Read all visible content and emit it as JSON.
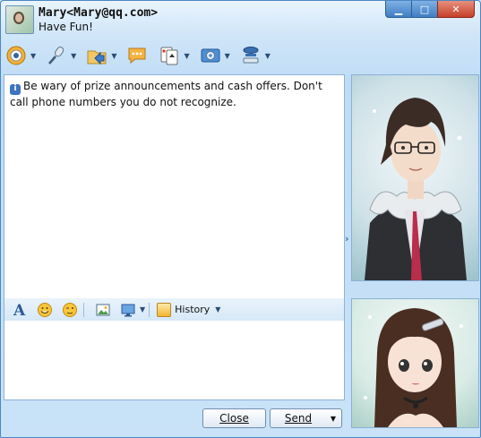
{
  "header": {
    "contact_title": "Mary<Mary@qq.com>",
    "status_message": "Have Fun!",
    "window_buttons": {
      "minimize": "▁",
      "maximize": "□",
      "close": "✕"
    }
  },
  "toolbar": {
    "items": [
      {
        "icon": "video-call-icon"
      },
      {
        "icon": "voice-call-icon"
      },
      {
        "icon": "send-file-icon"
      },
      {
        "icon": "sms-icon"
      },
      {
        "icon": "games-icon"
      },
      {
        "icon": "apps-icon"
      },
      {
        "icon": "more-icon"
      }
    ]
  },
  "messages": {
    "notice": "Be wary of prize announcements and cash offers. Don't call phone numbers you do not recognize."
  },
  "format_toolbar": {
    "history_label": "History"
  },
  "buttons": {
    "close_label": "Close",
    "send_label": "Send"
  },
  "colors": {
    "window_border": "#4a86c4",
    "accent": "#3d74bf"
  }
}
